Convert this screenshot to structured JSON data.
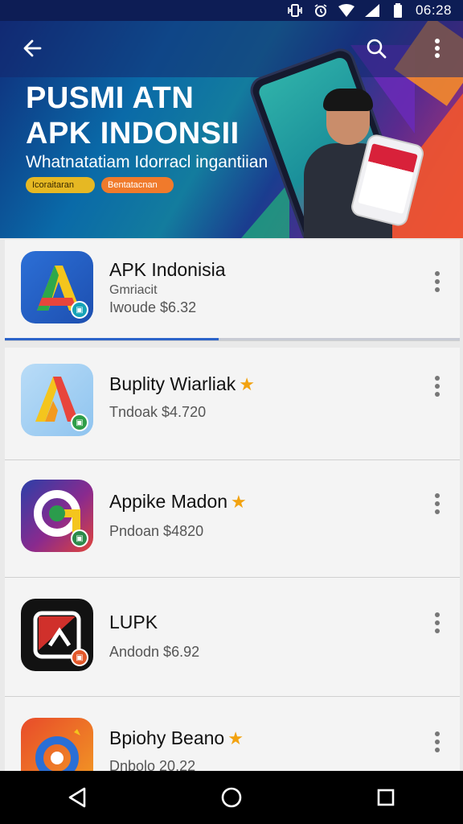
{
  "status_bar": {
    "time": "06:28"
  },
  "header": {
    "back_icon": "arrow-left-icon",
    "search_icon": "search-icon",
    "more_icon": "more-vert-icon"
  },
  "hero": {
    "title_line1": "PUSMI ATN",
    "title_line2": "APK INDONSII",
    "subtitle": "Whatnatatiam Idorracl ingantiian",
    "chip_1": "Icoraitaran",
    "chip_2": "Bentatacnan"
  },
  "apps": [
    {
      "name": "APK Indonisia",
      "line1": "Gmriacit",
      "line2": "Iwoude $6.32",
      "starred": false,
      "progress": 0.47
    },
    {
      "name": "Buplity Wiarliak",
      "line1": "",
      "line2": "Tndoak $4.720",
      "starred": true
    },
    {
      "name": "Appike Madon",
      "line1": "",
      "line2": "Pndoan $4820",
      "starred": true
    },
    {
      "name": "LUPK",
      "line1": "",
      "line2": "Andodn $6.92",
      "starred": false
    },
    {
      "name": "Bpiohy Beano",
      "line1": "",
      "line2": "Dnbolo 20.22",
      "starred": true
    }
  ],
  "colors": {
    "status_bar": "#0d1d55",
    "accent": "#2b63c9",
    "star": "#f2a20f"
  }
}
